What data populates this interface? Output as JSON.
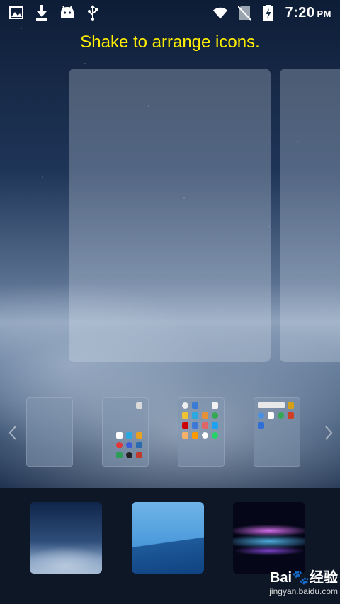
{
  "status_bar": {
    "time": "7:20",
    "ampm": "PM",
    "left_icons": [
      "image-icon",
      "download-icon",
      "android-icon",
      "usb-icon"
    ],
    "right_icons": [
      "wifi-icon",
      "no-sim-icon",
      "battery-charging-icon"
    ]
  },
  "hint_text": "Shake to arrange icons.",
  "hint_color": "#ffee00",
  "home_pages": {
    "thumbnails": [
      {
        "label": "empty page"
      },
      {
        "label": "page 2"
      },
      {
        "label": "page 3"
      },
      {
        "label": "page 4"
      }
    ],
    "prev_icon": "chevron-left-icon",
    "next_icon": "chevron-right-icon"
  },
  "wallpapers": [
    {
      "name": "night snow"
    },
    {
      "name": "blue waves"
    },
    {
      "name": "neon ribbons"
    }
  ],
  "watermark": {
    "logo": "Bai",
    "logo_paw": "🐾",
    "logo_tail": "经验",
    "url": "jingyan.baidu.com"
  }
}
